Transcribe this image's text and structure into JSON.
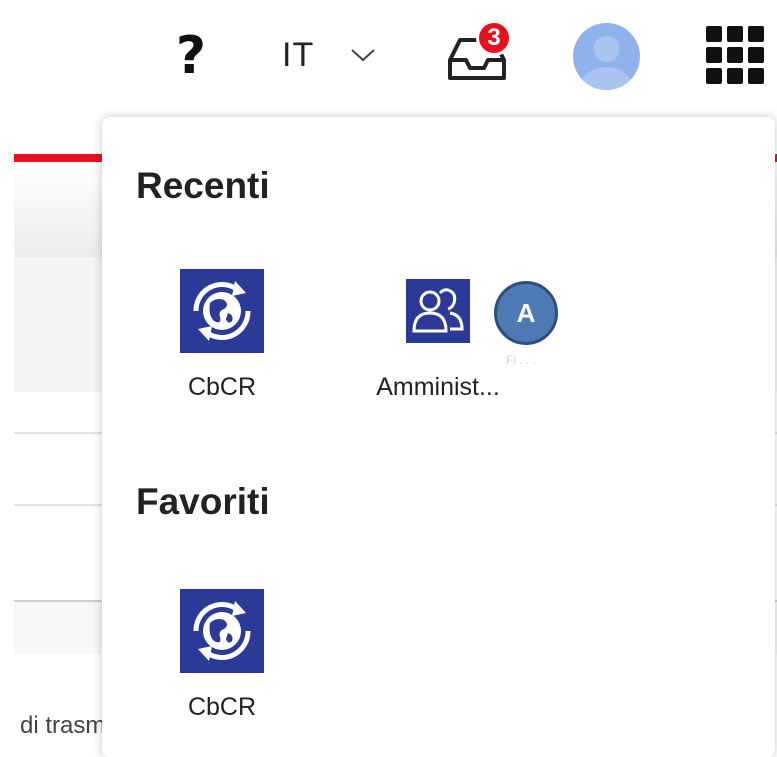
{
  "header": {
    "help_icon": "question-mark-icon",
    "language": {
      "selected": "IT"
    },
    "inbox": {
      "icon": "inbox-tray-icon",
      "badge_count": "3",
      "badge_color": "#e8101f"
    },
    "avatar": {
      "color": "#8fb2ec"
    },
    "apps_icon": "apps-grid-icon"
  },
  "background": {
    "accent_color": "#e8101f",
    "footer_text": "di trasm"
  },
  "menu": {
    "recent": {
      "title": "Recenti",
      "items": [
        {
          "label": "CbCR",
          "icon": "globe-refresh-icon",
          "icon_bg": "#2b3a97"
        },
        {
          "label": "Amminist...",
          "icon": "users-group-icon",
          "icon_bg": "#2b3a97"
        }
      ]
    },
    "favorites": {
      "title": "Favoriti",
      "items": [
        {
          "label": "CbCR",
          "icon": "globe-refresh-icon",
          "icon_bg": "#2b3a97"
        }
      ]
    }
  },
  "annotation": {
    "callout_label": "A",
    "faint_text": "Fi . . ."
  }
}
